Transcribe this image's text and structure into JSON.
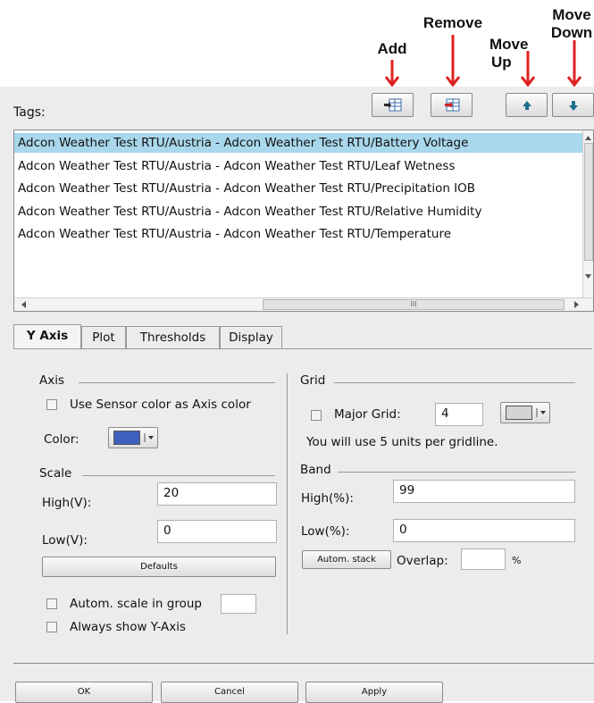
{
  "callouts": {
    "add": "Add",
    "remove": "Remove",
    "move_up_line1": "Move",
    "move_up_line2": "Up",
    "move_down_line1": "Move",
    "move_down_line2": "Down"
  },
  "tags": {
    "label": "Tags:",
    "items": [
      "Adcon Weather Test RTU/Austria - Adcon Weather Test RTU/Battery Voltage",
      "Adcon Weather Test RTU/Austria - Adcon Weather Test RTU/Leaf Wetness",
      "Adcon Weather Test RTU/Austria - Adcon Weather Test RTU/Precipitation IOB",
      "Adcon Weather Test RTU/Austria - Adcon Weather Test RTU/Relative Humidity",
      "Adcon Weather Test RTU/Austria - Adcon Weather Test RTU/Temperature"
    ],
    "scroll_grip": "III"
  },
  "tabs": [
    "Y Axis",
    "Plot",
    "Thresholds",
    "Display"
  ],
  "axis": {
    "title": "Axis",
    "use_sensor_color": "Use Sensor color as Axis color",
    "color_label": "Color:",
    "color_value": "#3f5fbf"
  },
  "scale": {
    "title": "Scale",
    "high_label": "High(V):",
    "high_value": "20",
    "low_label": "Low(V):",
    "low_value": "0",
    "defaults_button": "Defaults",
    "autom_scale": "Autom. scale in group",
    "always_show": "Always show Y-Axis"
  },
  "grid": {
    "title": "Grid",
    "major_grid_label": "Major Grid:",
    "major_grid_value": "4",
    "color_value": "#d4d4d4",
    "info": "You will use 5 units per gridline."
  },
  "band": {
    "title": "Band",
    "high_label": "High(%):",
    "high_value": "99",
    "low_label": "Low(%):",
    "low_value": "0",
    "autom_stack_button": "Autom. stack",
    "overlap_label": "Overlap:",
    "percent": "%"
  },
  "footer": {
    "ok": "OK",
    "cancel": "Cancel",
    "apply": "Apply"
  },
  "colors": {
    "selection": "#a9d7eb",
    "arrow": "#e02020",
    "panel": "#ececec"
  }
}
